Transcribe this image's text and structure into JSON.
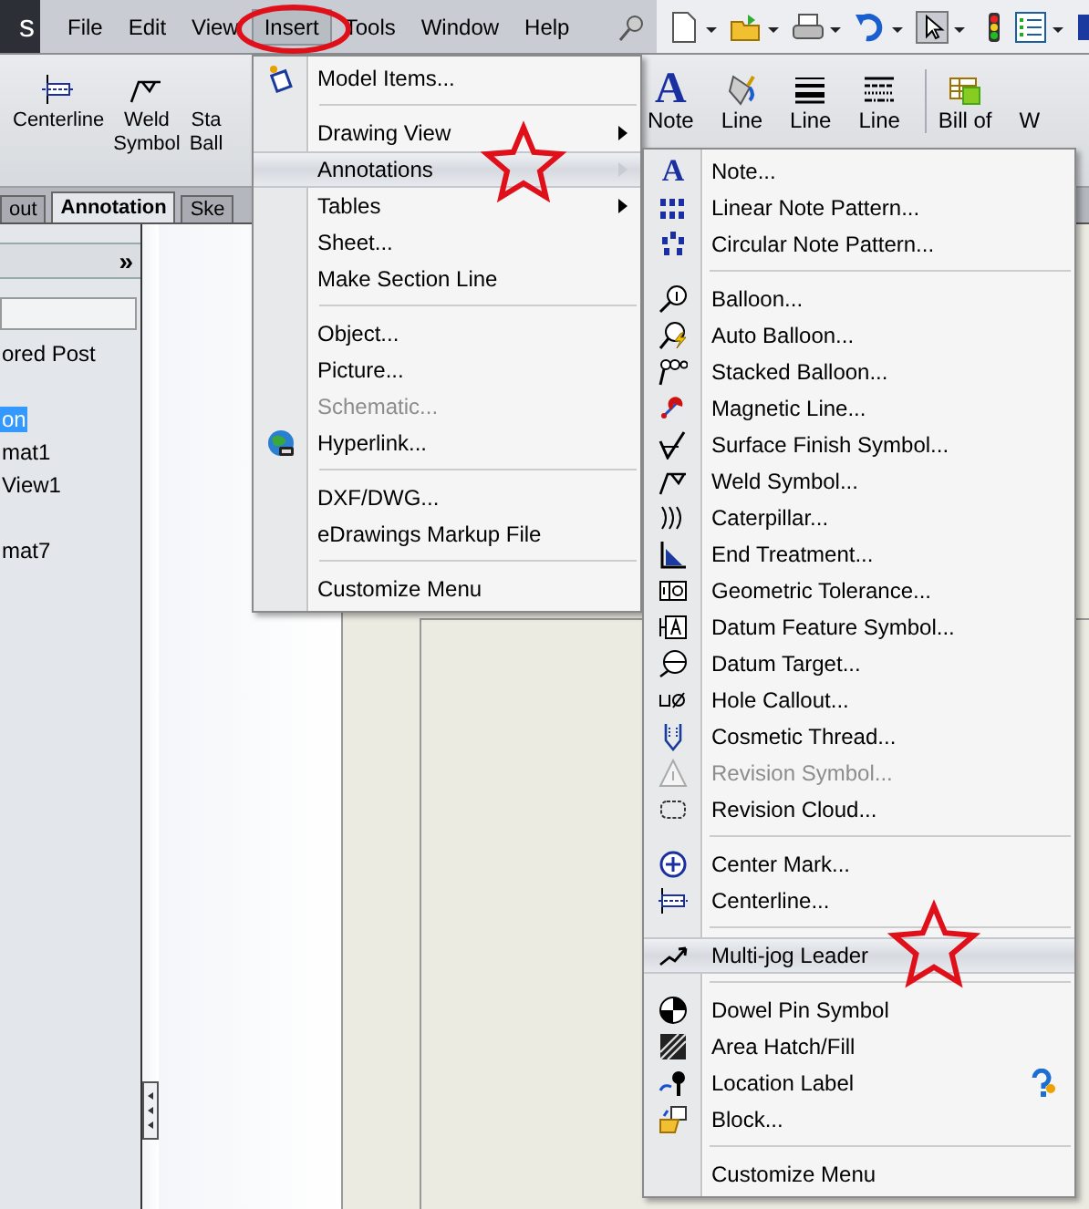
{
  "logo": {
    "text": "s"
  },
  "menu_bar": [
    {
      "label": "File",
      "selected": false
    },
    {
      "label": "Edit",
      "selected": false
    },
    {
      "label": "View",
      "selected": false
    },
    {
      "label": "Insert",
      "selected": true
    },
    {
      "label": "Tools",
      "selected": false
    },
    {
      "label": "Window",
      "selected": false
    },
    {
      "label": "Help",
      "selected": false
    }
  ],
  "ribbon_left": [
    {
      "lines": [
        "Centerline"
      ]
    },
    {
      "lines": [
        "Weld",
        "Symbol"
      ]
    },
    {
      "lines": [
        "Sta",
        "Ball"
      ]
    }
  ],
  "ribbon_right": [
    {
      "lines": [
        "Note"
      ],
      "glyph": "A"
    },
    {
      "lines": [
        "Line"
      ]
    },
    {
      "lines": [
        "Line"
      ]
    },
    {
      "lines": [
        "Line"
      ]
    },
    {
      "lines": [
        "Bill of"
      ]
    },
    {
      "lines": [
        "W"
      ]
    }
  ],
  "tabs": [
    {
      "label": "out",
      "selected": false
    },
    {
      "label": "Annotation",
      "selected": true
    },
    {
      "label": "Ske",
      "selected": false
    }
  ],
  "panel": {
    "expand": "»",
    "tree": [
      {
        "label": "ored Post",
        "selected": false
      },
      {
        "label": "on",
        "selected": true
      },
      {
        "label": "mat1",
        "selected": false
      },
      {
        "label": "View1",
        "selected": false
      },
      {
        "label": "mat7",
        "selected": false
      }
    ]
  },
  "insert_menu": [
    {
      "kind": "item",
      "label": "Model Items...",
      "submenu": false,
      "selected": false,
      "disabled": false
    },
    {
      "kind": "separator"
    },
    {
      "kind": "item",
      "label": "Drawing View",
      "submenu": true,
      "selected": false,
      "disabled": false
    },
    {
      "kind": "item",
      "label": "Annotations",
      "submenu": true,
      "selected": true,
      "disabled": false
    },
    {
      "kind": "item",
      "label": "Tables",
      "submenu": true,
      "selected": false,
      "disabled": false
    },
    {
      "kind": "item",
      "label": "Sheet...",
      "submenu": false,
      "selected": false,
      "disabled": false
    },
    {
      "kind": "item",
      "label": "Make Section Line",
      "submenu": false,
      "selected": false,
      "disabled": false
    },
    {
      "kind": "separator"
    },
    {
      "kind": "item",
      "label": "Object...",
      "submenu": false,
      "selected": false,
      "disabled": false
    },
    {
      "kind": "item",
      "label": "Picture...",
      "submenu": false,
      "selected": false,
      "disabled": false
    },
    {
      "kind": "item",
      "label": "Schematic...",
      "submenu": false,
      "selected": false,
      "disabled": true
    },
    {
      "kind": "item",
      "label": "Hyperlink...",
      "submenu": false,
      "selected": false,
      "disabled": false
    },
    {
      "kind": "separator"
    },
    {
      "kind": "item",
      "label": "DXF/DWG...",
      "submenu": false,
      "selected": false,
      "disabled": false
    },
    {
      "kind": "item",
      "label": "eDrawings Markup File",
      "submenu": false,
      "selected": false,
      "disabled": false
    },
    {
      "kind": "separator"
    },
    {
      "kind": "item",
      "label": "Customize Menu",
      "submenu": false,
      "selected": false,
      "disabled": false
    }
  ],
  "annotations_menu": [
    {
      "kind": "item",
      "label": "Note...",
      "glyph": "A",
      "selected": false,
      "disabled": false
    },
    {
      "kind": "item",
      "label": "Linear Note Pattern...",
      "selected": false,
      "disabled": false
    },
    {
      "kind": "item",
      "label": "Circular Note Pattern...",
      "selected": false,
      "disabled": false
    },
    {
      "kind": "separator"
    },
    {
      "kind": "item",
      "label": "Balloon...",
      "selected": false,
      "disabled": false
    },
    {
      "kind": "item",
      "label": "Auto Balloon...",
      "selected": false,
      "disabled": false
    },
    {
      "kind": "item",
      "label": "Stacked Balloon...",
      "selected": false,
      "disabled": false
    },
    {
      "kind": "item",
      "label": "Magnetic Line...",
      "selected": false,
      "disabled": false
    },
    {
      "kind": "item",
      "label": "Surface Finish Symbol...",
      "selected": false,
      "disabled": false
    },
    {
      "kind": "item",
      "label": "Weld Symbol...",
      "selected": false,
      "disabled": false
    },
    {
      "kind": "item",
      "label": "Caterpillar...",
      "selected": false,
      "disabled": false
    },
    {
      "kind": "item",
      "label": "End Treatment...",
      "selected": false,
      "disabled": false
    },
    {
      "kind": "item",
      "label": "Geometric Tolerance...",
      "selected": false,
      "disabled": false
    },
    {
      "kind": "item",
      "label": "Datum Feature Symbol...",
      "selected": false,
      "disabled": false
    },
    {
      "kind": "item",
      "label": "Datum Target...",
      "selected": false,
      "disabled": false
    },
    {
      "kind": "item",
      "label": "Hole Callout...",
      "selected": false,
      "disabled": false
    },
    {
      "kind": "item",
      "label": "Cosmetic Thread...",
      "selected": false,
      "disabled": false
    },
    {
      "kind": "item",
      "label": "Revision Symbol...",
      "selected": false,
      "disabled": true
    },
    {
      "kind": "item",
      "label": "Revision Cloud...",
      "selected": false,
      "disabled": false
    },
    {
      "kind": "separator"
    },
    {
      "kind": "item",
      "label": "Center Mark...",
      "selected": false,
      "disabled": false
    },
    {
      "kind": "item",
      "label": "Centerline...",
      "selected": false,
      "disabled": false
    },
    {
      "kind": "separator"
    },
    {
      "kind": "item",
      "label": "Multi-jog Leader",
      "selected": true,
      "disabled": false
    },
    {
      "kind": "separator"
    },
    {
      "kind": "item",
      "label": "Dowel Pin Symbol",
      "selected": false,
      "disabled": false
    },
    {
      "kind": "item",
      "label": "Area Hatch/Fill",
      "selected": false,
      "disabled": false
    },
    {
      "kind": "item",
      "label": "Location Label",
      "selected": false,
      "disabled": false
    },
    {
      "kind": "item",
      "label": "Block...",
      "selected": false,
      "disabled": false
    },
    {
      "kind": "separator"
    },
    {
      "kind": "item",
      "label": "Customize Menu",
      "selected": false,
      "disabled": false
    }
  ]
}
